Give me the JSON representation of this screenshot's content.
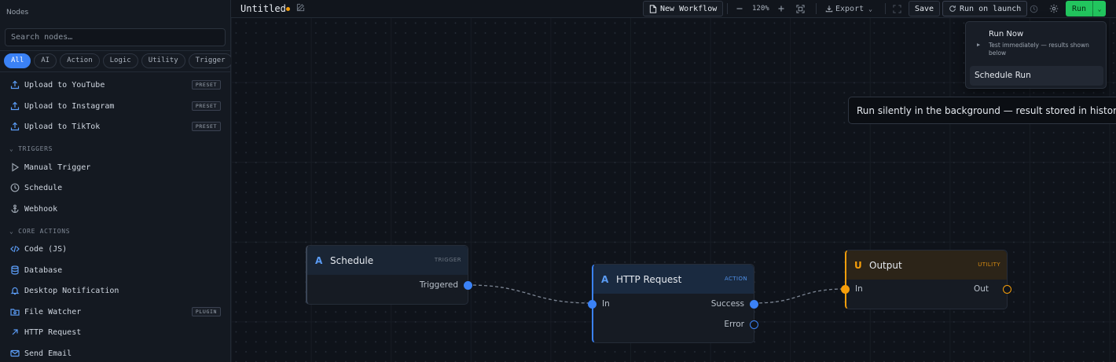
{
  "sidebar": {
    "title": "Nodes",
    "search_placeholder": "Search nodes…",
    "filters": [
      {
        "label": "All",
        "active": true
      },
      {
        "label": "AI"
      },
      {
        "label": "Action"
      },
      {
        "label": "Logic"
      },
      {
        "label": "Utility"
      },
      {
        "label": "Trigger"
      }
    ],
    "presets": [
      {
        "label": "Upload to YouTube",
        "badge": "PRESET",
        "icon": "upload-icon"
      },
      {
        "label": "Upload to Instagram",
        "badge": "PRESET",
        "icon": "upload-icon"
      },
      {
        "label": "Upload to TikTok",
        "badge": "PRESET",
        "icon": "upload-icon"
      }
    ],
    "sections": {
      "triggers": {
        "label": "TRIGGERS",
        "items": [
          {
            "label": "Manual Trigger",
            "icon": "play-icon"
          },
          {
            "label": "Schedule",
            "icon": "clock-icon"
          },
          {
            "label": "Webhook",
            "icon": "anchor-icon"
          }
        ]
      },
      "core_actions": {
        "label": "CORE ACTIONS",
        "items": [
          {
            "label": "Code (JS)",
            "icon": "code-icon"
          },
          {
            "label": "Database",
            "icon": "database-icon"
          },
          {
            "label": "Desktop Notification",
            "icon": "bell-icon"
          },
          {
            "label": "File Watcher",
            "icon": "folder-icon",
            "badge": "PLUGIN"
          },
          {
            "label": "HTTP Request",
            "icon": "arrow-up-right-icon"
          },
          {
            "label": "Send Email",
            "icon": "mail-icon"
          }
        ]
      }
    }
  },
  "topbar": {
    "title": "Untitled",
    "new_workflow": "New Workflow",
    "zoom": "120%",
    "export": "Export",
    "save": "Save",
    "run_on_launch": "Run on launch",
    "run": "Run"
  },
  "run_menu": {
    "run_now": {
      "title": "Run Now",
      "desc": "Test immediately — results shown below"
    },
    "schedule_run": {
      "title": "Schedule Run"
    }
  },
  "tooltip": "Run silently in the background — result stored in history",
  "nodes": {
    "schedule": {
      "letter": "A",
      "title": "Schedule",
      "type": "TRIGGER",
      "outputs": [
        "Triggered"
      ]
    },
    "http": {
      "letter": "A",
      "title": "HTTP Request",
      "type": "ACTION",
      "inputs": [
        "In"
      ],
      "outputs": [
        "Success",
        "Error"
      ]
    },
    "output": {
      "letter": "U",
      "title": "Output",
      "type": "UTILITY",
      "inputs": [
        "In"
      ],
      "outputs": [
        "Out"
      ]
    }
  },
  "colors": {
    "accent": "#3b82f6",
    "run_green": "#22c55e",
    "utility_orange": "#f59e0b",
    "dirty_dot": "#f59e0b"
  }
}
